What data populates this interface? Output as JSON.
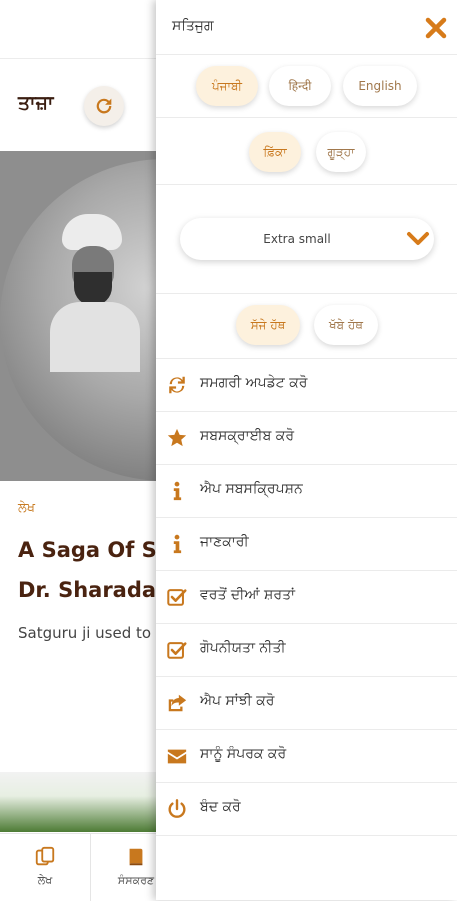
{
  "background": {
    "latest_title": "ਤਾਜ਼ਾ",
    "article_category": "ਲੇਖ",
    "article_title_line1": "A Saga Of Sı",
    "article_title_line2": "Dr. Sharada",
    "article_subtitle": "Satguru ji used to",
    "bottom_nav": [
      {
        "label": "ਲੇਖ",
        "icon": "articles-icon"
      },
      {
        "label": "ਸੰਸਕਰਣ",
        "icon": "book-icon"
      }
    ]
  },
  "drawer": {
    "title": "ਸਤਿਜੁਗ",
    "language_options": [
      "ਪੰਜਾਬੀ",
      "हिन्दी",
      "English"
    ],
    "selected_language": "ਪੰਜਾਬੀ",
    "theme_options": [
      "ਫ਼ਿੱਕਾ",
      "ਗੂੜ੍ਹਾ"
    ],
    "selected_theme": "ਫ਼ਿੱਕਾ",
    "font_size": "Extra small",
    "hand_options": [
      "ਸੱਜੇ ਹੱਥ",
      "ਖੱਬੇ ਹੱਥ"
    ],
    "selected_hand": "ਸੱਜੇ ਹੱਥ",
    "menu": [
      {
        "label": "ਸਮਗਰੀ ਅਪਡੇਟ ਕਰੋ",
        "icon": "refresh-icon"
      },
      {
        "label": "ਸਬਸਕ੍ਰਾਈਬ ਕਰੋ",
        "icon": "star-icon"
      },
      {
        "label": "ਐਪ ਸਬਸਕ੍ਰਿਪਸ਼ਨ",
        "icon": "info-icon"
      },
      {
        "label": "ਜਾਣਕਾਰੀ",
        "icon": "info-icon"
      },
      {
        "label": "ਵਰਤੋਂ ਦੀਆਂ ਸ਼ਰਤਾਂ",
        "icon": "checkbox-icon"
      },
      {
        "label": "ਗੋਪਨੀਯਤਾ ਨੀਤੀ",
        "icon": "checkbox-icon"
      },
      {
        "label": "ਐਪ ਸਾਂਝੀ ਕਰੋ",
        "icon": "share-icon"
      },
      {
        "label": "ਸਾਨੂੰ ਸੰਪਰਕ ਕਰੋ",
        "icon": "envelope-icon"
      },
      {
        "label": "ਬੰਦ ਕਰੋ",
        "icon": "power-icon"
      }
    ]
  },
  "colors": {
    "accent": "#c8781e",
    "close_icon": "#d77b1a",
    "active_pill": "#fdf1dd",
    "dark_text": "#3a1d10"
  }
}
